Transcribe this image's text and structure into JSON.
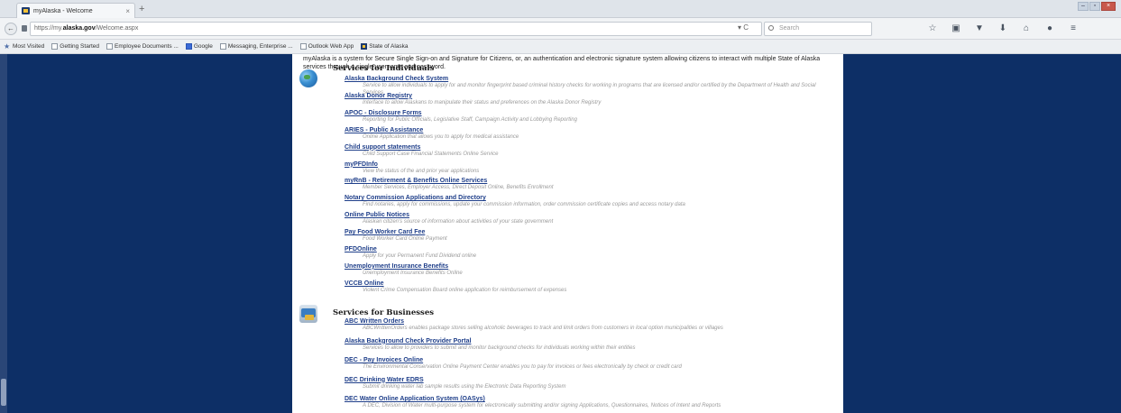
{
  "browser": {
    "tab_title": "myAlaska - Welcome",
    "tab_close": "×",
    "new_tab": "+",
    "window_controls": [
      "–",
      "▫",
      "×"
    ],
    "back": "←",
    "url_prefix": "https://my.",
    "url_domain": "alaska.gov",
    "url_path": "/Welcome.aspx",
    "reload": "▾ C",
    "search_placeholder": "Search",
    "toolbar_icons": [
      "star-icon",
      "clipboard-icon",
      "pocket-icon",
      "download-icon",
      "home-icon",
      "chat-icon",
      "menu-icon"
    ],
    "toolbar_glyphs": [
      "☆",
      "▣",
      "▼",
      "⬇",
      "⌂",
      "●",
      "≡"
    ]
  },
  "bookmarks": [
    {
      "label": "Most Visited",
      "icon": "star"
    },
    {
      "label": "Getting Started",
      "icon": "page"
    },
    {
      "label": "Employee Documents ...",
      "icon": "page"
    },
    {
      "label": "Google",
      "icon": "google"
    },
    {
      "label": "Messaging, Enterprise ...",
      "icon": "page"
    },
    {
      "label": "Outlook Web App",
      "icon": "page"
    },
    {
      "label": "State of Alaska",
      "icon": "alaska"
    }
  ],
  "page": {
    "intro": "myAlaska is a system for Secure Single Sign-on and Signature for Citizens, or, an authentication and electronic signature system allowing citizens to interact with multiple State of Alaska services through a single username and password.",
    "individuals_title": "Services for Individuals",
    "businesses_title": "Services for Businesses",
    "individuals": [
      {
        "name": "Alaska Background Check System",
        "desc": "Service to allow individuals to apply for and monitor fingerprint based criminal history checks for working in programs that are licensed and/or certified by the Department of Health and Social Services"
      },
      {
        "name": "Alaska Donor Registry",
        "desc": "Interface to allow Alaskans to manipulate their status and preferences on the Alaska Donor Registry"
      },
      {
        "name": "APOC - Disclosure Forms",
        "desc": "Reporting for Public Officials, Legislative Staff, Campaign Activity and Lobbying Reporting"
      },
      {
        "name": "ARIES - Public Assistance",
        "desc": "Online Application that allows you to apply for medical assistance"
      },
      {
        "name": "Child support statements",
        "desc": "Child Support Case Financial Statements Online Service"
      },
      {
        "name": "myPFDInfo",
        "desc": "View the status of the and prior year applications"
      },
      {
        "name": "myRnB - Retirement & Benefits Online Services",
        "desc": "Member Services, Employer Access, Direct Deposit Online, Benefits Enrollment"
      },
      {
        "name": "Notary Commission Applications and Directory",
        "desc": "Find notaries, apply for commissions, update your commission information, order commission certificate copies and access notary data"
      },
      {
        "name": "Online Public Notices",
        "desc": "Alaskan citizen's source of information about activities of your state government"
      },
      {
        "name": "Pay Food Worker Card Fee",
        "desc": "Food Worker Card Online Payment"
      },
      {
        "name": "PFDOnline",
        "desc": "Apply for your Permanent Fund Dividend online"
      },
      {
        "name": "Unemployment Insurance Benefits",
        "desc": "Unemployment Insurance Benefits Online"
      },
      {
        "name": "VCCB Online",
        "desc": "Violent Crime Compensation Board online application for reimbursement of expenses"
      }
    ],
    "businesses": [
      {
        "name": "ABC Written Orders",
        "desc": "ABCWrittenOrders enables package stores selling alcoholic beverages to track and limit orders from customers in local option municipalities or villages"
      },
      {
        "name": "Alaska Background Check Provider Portal",
        "desc": "Services to allow to providers to submit and monitor background checks for individuals working within their entities"
      },
      {
        "name": "DEC - Pay Invoices Online",
        "desc": "The Environmental Conservation Online Payment Center enables you to pay for invoices or fees electronically by check or credit card"
      },
      {
        "name": "DEC Drinking Water EDRS",
        "desc": "Submit drinking water lab sample results using the Electronic Data Reporting System"
      },
      {
        "name": "DEC Water Online Application System (OASys)",
        "desc": "A DEC, Division of Water multi-purpose system for electronically submitting and/or signing Applications, Questionnaires, Notices of Intent and Reports"
      }
    ]
  },
  "colors": {
    "sidebar": "#0d2f66",
    "link": "#1f3f8a",
    "desc": "#9a9a9a"
  }
}
